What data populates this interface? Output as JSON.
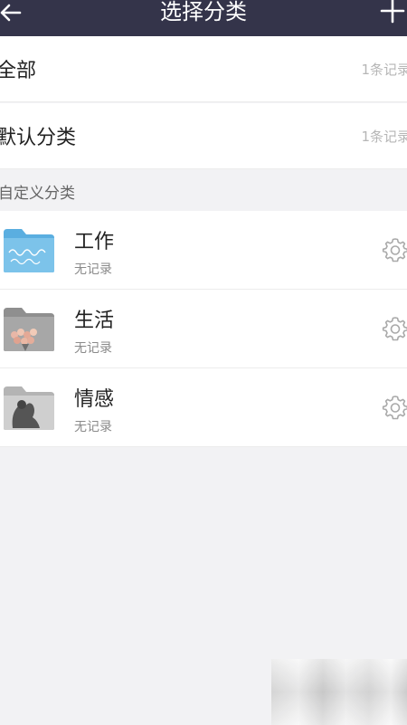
{
  "header": {
    "title": "选择分类",
    "back_icon": "back-arrow-icon",
    "add_icon": "plus-icon"
  },
  "all": {
    "label": "全部",
    "count": "1条记录"
  },
  "default": {
    "label": "默认分类",
    "count": "1条记录"
  },
  "custom_section": {
    "title": "自定义分类"
  },
  "categories": [
    {
      "name": "工作",
      "sub": "无记录",
      "thumb_color": "#5aaee0"
    },
    {
      "name": "生活",
      "sub": "无记录",
      "thumb_color": "#9a9a9a"
    },
    {
      "name": "情感",
      "sub": "无记录",
      "thumb_color": "#bdbdbd"
    }
  ],
  "colors": {
    "navbar": "#34344a",
    "background": "#f2f2f4",
    "muted_text": "#b6b6b6"
  }
}
